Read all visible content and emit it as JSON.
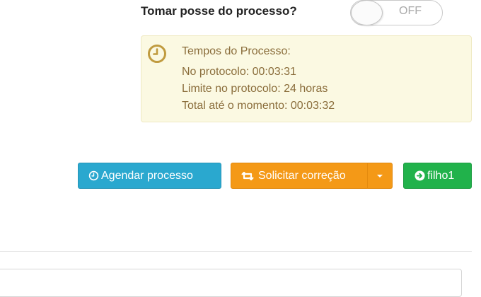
{
  "posse": {
    "label": "Tomar posse do processo?",
    "toggle_text": "OFF"
  },
  "tempos": {
    "icon": "clock-icon",
    "title": "Tempos do Processo:",
    "lines": [
      "No protocolo: 00:03:31",
      "Limite no protocolo: 24 horas",
      "Total até o momento: 00:03:32"
    ]
  },
  "actions": {
    "agendar": {
      "label": "Agendar processo",
      "icon": "clock-icon",
      "color": "#2aa8cf"
    },
    "solicitar": {
      "label": "Solicitar correção",
      "icon": "retweet-icon",
      "color": "#f49917"
    },
    "filho": {
      "label": "filho1",
      "icon": "arrow-circle-right-icon",
      "color": "#21b24b"
    }
  },
  "colors": {
    "alert_bg": "#fbf9e2",
    "alert_text": "#8a6d3b",
    "toggle_off_text": "#a9a9a9"
  }
}
